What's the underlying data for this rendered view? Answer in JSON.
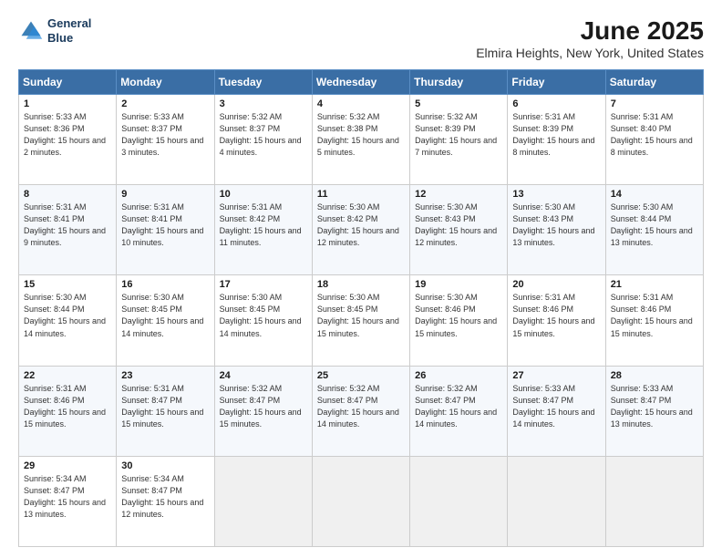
{
  "header": {
    "logo_line1": "General",
    "logo_line2": "Blue",
    "title": "June 2025",
    "subtitle": "Elmira Heights, New York, United States"
  },
  "days_of_week": [
    "Sunday",
    "Monday",
    "Tuesday",
    "Wednesday",
    "Thursday",
    "Friday",
    "Saturday"
  ],
  "weeks": [
    [
      {
        "day": "1",
        "sunrise": "5:33 AM",
        "sunset": "8:36 PM",
        "daylight": "15 hours and 2 minutes."
      },
      {
        "day": "2",
        "sunrise": "5:33 AM",
        "sunset": "8:37 PM",
        "daylight": "15 hours and 3 minutes."
      },
      {
        "day": "3",
        "sunrise": "5:32 AM",
        "sunset": "8:37 PM",
        "daylight": "15 hours and 4 minutes."
      },
      {
        "day": "4",
        "sunrise": "5:32 AM",
        "sunset": "8:38 PM",
        "daylight": "15 hours and 5 minutes."
      },
      {
        "day": "5",
        "sunrise": "5:32 AM",
        "sunset": "8:39 PM",
        "daylight": "15 hours and 7 minutes."
      },
      {
        "day": "6",
        "sunrise": "5:31 AM",
        "sunset": "8:39 PM",
        "daylight": "15 hours and 8 minutes."
      },
      {
        "day": "7",
        "sunrise": "5:31 AM",
        "sunset": "8:40 PM",
        "daylight": "15 hours and 8 minutes."
      }
    ],
    [
      {
        "day": "8",
        "sunrise": "5:31 AM",
        "sunset": "8:41 PM",
        "daylight": "15 hours and 9 minutes."
      },
      {
        "day": "9",
        "sunrise": "5:31 AM",
        "sunset": "8:41 PM",
        "daylight": "15 hours and 10 minutes."
      },
      {
        "day": "10",
        "sunrise": "5:31 AM",
        "sunset": "8:42 PM",
        "daylight": "15 hours and 11 minutes."
      },
      {
        "day": "11",
        "sunrise": "5:30 AM",
        "sunset": "8:42 PM",
        "daylight": "15 hours and 12 minutes."
      },
      {
        "day": "12",
        "sunrise": "5:30 AM",
        "sunset": "8:43 PM",
        "daylight": "15 hours and 12 minutes."
      },
      {
        "day": "13",
        "sunrise": "5:30 AM",
        "sunset": "8:43 PM",
        "daylight": "15 hours and 13 minutes."
      },
      {
        "day": "14",
        "sunrise": "5:30 AM",
        "sunset": "8:44 PM",
        "daylight": "15 hours and 13 minutes."
      }
    ],
    [
      {
        "day": "15",
        "sunrise": "5:30 AM",
        "sunset": "8:44 PM",
        "daylight": "15 hours and 14 minutes."
      },
      {
        "day": "16",
        "sunrise": "5:30 AM",
        "sunset": "8:45 PM",
        "daylight": "15 hours and 14 minutes."
      },
      {
        "day": "17",
        "sunrise": "5:30 AM",
        "sunset": "8:45 PM",
        "daylight": "15 hours and 14 minutes."
      },
      {
        "day": "18",
        "sunrise": "5:30 AM",
        "sunset": "8:45 PM",
        "daylight": "15 hours and 15 minutes."
      },
      {
        "day": "19",
        "sunrise": "5:30 AM",
        "sunset": "8:46 PM",
        "daylight": "15 hours and 15 minutes."
      },
      {
        "day": "20",
        "sunrise": "5:31 AM",
        "sunset": "8:46 PM",
        "daylight": "15 hours and 15 minutes."
      },
      {
        "day": "21",
        "sunrise": "5:31 AM",
        "sunset": "8:46 PM",
        "daylight": "15 hours and 15 minutes."
      }
    ],
    [
      {
        "day": "22",
        "sunrise": "5:31 AM",
        "sunset": "8:46 PM",
        "daylight": "15 hours and 15 minutes."
      },
      {
        "day": "23",
        "sunrise": "5:31 AM",
        "sunset": "8:47 PM",
        "daylight": "15 hours and 15 minutes."
      },
      {
        "day": "24",
        "sunrise": "5:32 AM",
        "sunset": "8:47 PM",
        "daylight": "15 hours and 15 minutes."
      },
      {
        "day": "25",
        "sunrise": "5:32 AM",
        "sunset": "8:47 PM",
        "daylight": "15 hours and 14 minutes."
      },
      {
        "day": "26",
        "sunrise": "5:32 AM",
        "sunset": "8:47 PM",
        "daylight": "15 hours and 14 minutes."
      },
      {
        "day": "27",
        "sunrise": "5:33 AM",
        "sunset": "8:47 PM",
        "daylight": "15 hours and 14 minutes."
      },
      {
        "day": "28",
        "sunrise": "5:33 AM",
        "sunset": "8:47 PM",
        "daylight": "15 hours and 13 minutes."
      }
    ],
    [
      {
        "day": "29",
        "sunrise": "5:34 AM",
        "sunset": "8:47 PM",
        "daylight": "15 hours and 13 minutes."
      },
      {
        "day": "30",
        "sunrise": "5:34 AM",
        "sunset": "8:47 PM",
        "daylight": "15 hours and 12 minutes."
      },
      null,
      null,
      null,
      null,
      null
    ]
  ]
}
